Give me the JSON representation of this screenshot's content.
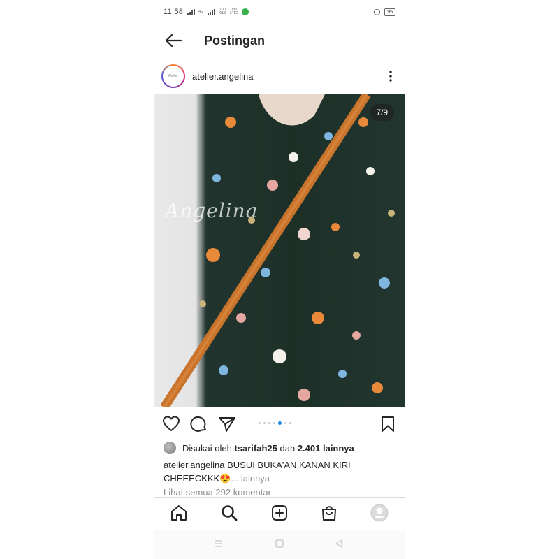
{
  "status_bar": {
    "time": "11.58",
    "network_label": "4G",
    "speed_value": "100",
    "speed_unit": "KB/S",
    "network_type_1": "VO",
    "network_type_2": "LTE2",
    "battery": "95"
  },
  "header": {
    "title": "Postingan"
  },
  "post": {
    "username": "atelier.angelina",
    "avatar_text": "Atelier",
    "image_counter": "7/9",
    "watermark": "Angelina",
    "likes_prefix": "Disukai oleh",
    "likes_user": "tsarifah25",
    "likes_mid": "dan",
    "likes_count": "2.401 lainnya",
    "caption_user": "atelier.angelina",
    "caption_text": "BUSUI BUKA'AN KANAN KIRI CHEEECKKK😍",
    "caption_more": "... lainnya",
    "comments_link": "Lihat semua 292 komentar"
  },
  "carousel": {
    "total": 9,
    "active_index": 6
  },
  "icons": {
    "back": "arrow-left-icon",
    "more": "more-vertical-icon",
    "like": "heart-icon",
    "comment": "comment-icon",
    "share": "send-icon",
    "save": "bookmark-icon",
    "nav_home": "home-icon",
    "nav_search": "search-icon",
    "nav_add": "add-post-icon",
    "nav_shop": "shop-bag-icon",
    "nav_profile": "profile-avatar-icon"
  },
  "colors": {
    "carousel_active": "#1e88e5",
    "text_primary": "#262626",
    "text_secondary": "#8e8e8e"
  }
}
